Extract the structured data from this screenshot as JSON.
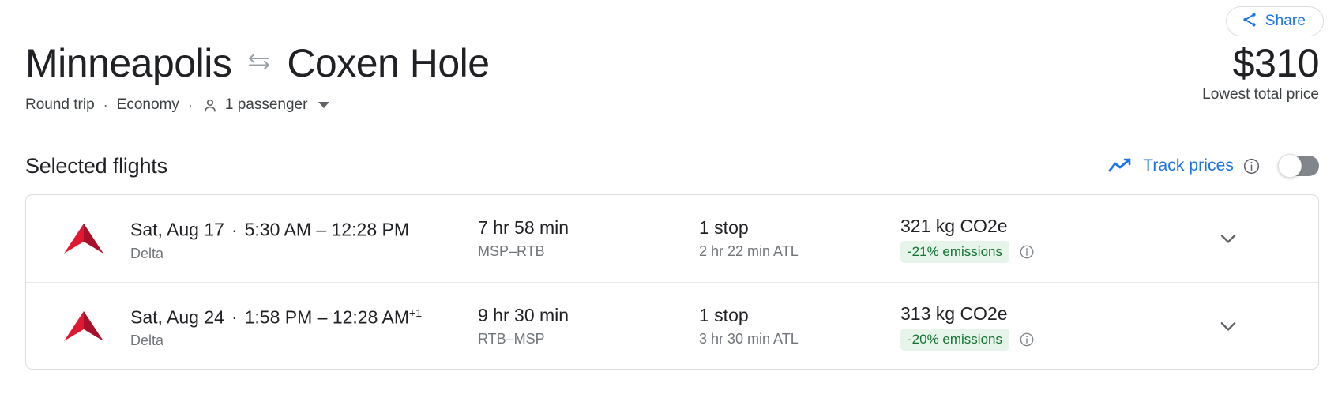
{
  "share": {
    "label": "Share",
    "icon": "share-icon"
  },
  "header": {
    "origin": "Minneapolis",
    "swap_icon": "swap-horizontal-icon",
    "destination": "Coxen Hole",
    "trip_type": "Round trip",
    "separator": "·",
    "cabin": "Economy",
    "passenger_icon": "person-icon",
    "passengers": "1 passenger",
    "price": "$310",
    "price_caption": "Lowest total price"
  },
  "selected_flights": {
    "title": "Selected flights",
    "track_prices": {
      "icon": "trending-up-icon",
      "label": "Track prices",
      "info_icon": "info-icon",
      "toggle_state": "off"
    },
    "accent_color": "#1a73e8",
    "rows": [
      {
        "airline_logo": "delta-logo",
        "date": "Sat, Aug 17",
        "separator": "·",
        "times": "5:30 AM – 12:28 PM",
        "times_superscript": "",
        "airline": "Delta",
        "duration": "7 hr 58 min",
        "route": "MSP–RTB",
        "stops": "1 stop",
        "layover": "2 hr 22 min ATL",
        "emissions": "321 kg CO2e",
        "emissions_badge": "-21% emissions",
        "emissions_info_icon": "info-icon",
        "expand_icon": "chevron-down-icon"
      },
      {
        "airline_logo": "delta-logo",
        "date": "Sat, Aug 24",
        "separator": "·",
        "times": "1:58 PM – 12:28 AM",
        "times_superscript": "+1",
        "airline": "Delta",
        "duration": "9 hr 30 min",
        "route": "RTB–MSP",
        "stops": "1 stop",
        "layover": "3 hr 30 min ATL",
        "emissions": "313 kg CO2e",
        "emissions_badge": "-20% emissions",
        "emissions_info_icon": "info-icon",
        "expand_icon": "chevron-down-icon"
      }
    ]
  },
  "colors": {
    "accent_blue": "#1a73e8",
    "badge_bg": "#e6f4ea",
    "badge_text": "#137333",
    "delta_red_light": "#e01933",
    "delta_red_dark": "#a8102a",
    "text_primary": "#202124",
    "text_secondary": "#70757a"
  }
}
